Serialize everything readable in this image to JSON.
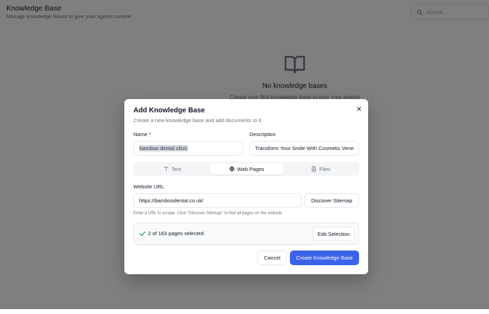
{
  "header": {
    "title": "Knowledge Base",
    "subtitle": "Manage knowledge bases to give your agents context",
    "search_placeholder": "Search..."
  },
  "empty_state": {
    "icon": "book-open-icon",
    "title": "No knowledge bases",
    "subtitle": "Create your first knowledge base to give your agents"
  },
  "modal": {
    "title": "Add Knowledge Base",
    "subtitle": "Create a new knowledge base and add documents to it",
    "name_label": "Name *",
    "name_value": "bamboo dental clinic",
    "description_label": "Description",
    "description_value": "Transform Your Smile With Cosmetic Vene",
    "tabs": [
      {
        "label": "Text",
        "icon": "text-icon",
        "active": false
      },
      {
        "label": "Web Pages",
        "icon": "globe-icon",
        "active": true
      },
      {
        "label": "Files",
        "icon": "file-icon",
        "active": false
      }
    ],
    "url_label": "Website URL",
    "url_value": "https://bamboodental.co.uk/",
    "discover_label": "Discover Sitemap",
    "hint": "Enter a URL to scrape. Click \"Discover Sitemap\" to find all pages on the website.",
    "selection_text": "2 of 163 pages selected",
    "edit_selection_label": "Edit Selection",
    "cancel_label": "Cancel",
    "create_label": "Create Knowledge Base"
  },
  "colors": {
    "primary": "#3b63e8",
    "overlay": "rgba(0,0,0,0.5)",
    "check": "#16a34a"
  }
}
